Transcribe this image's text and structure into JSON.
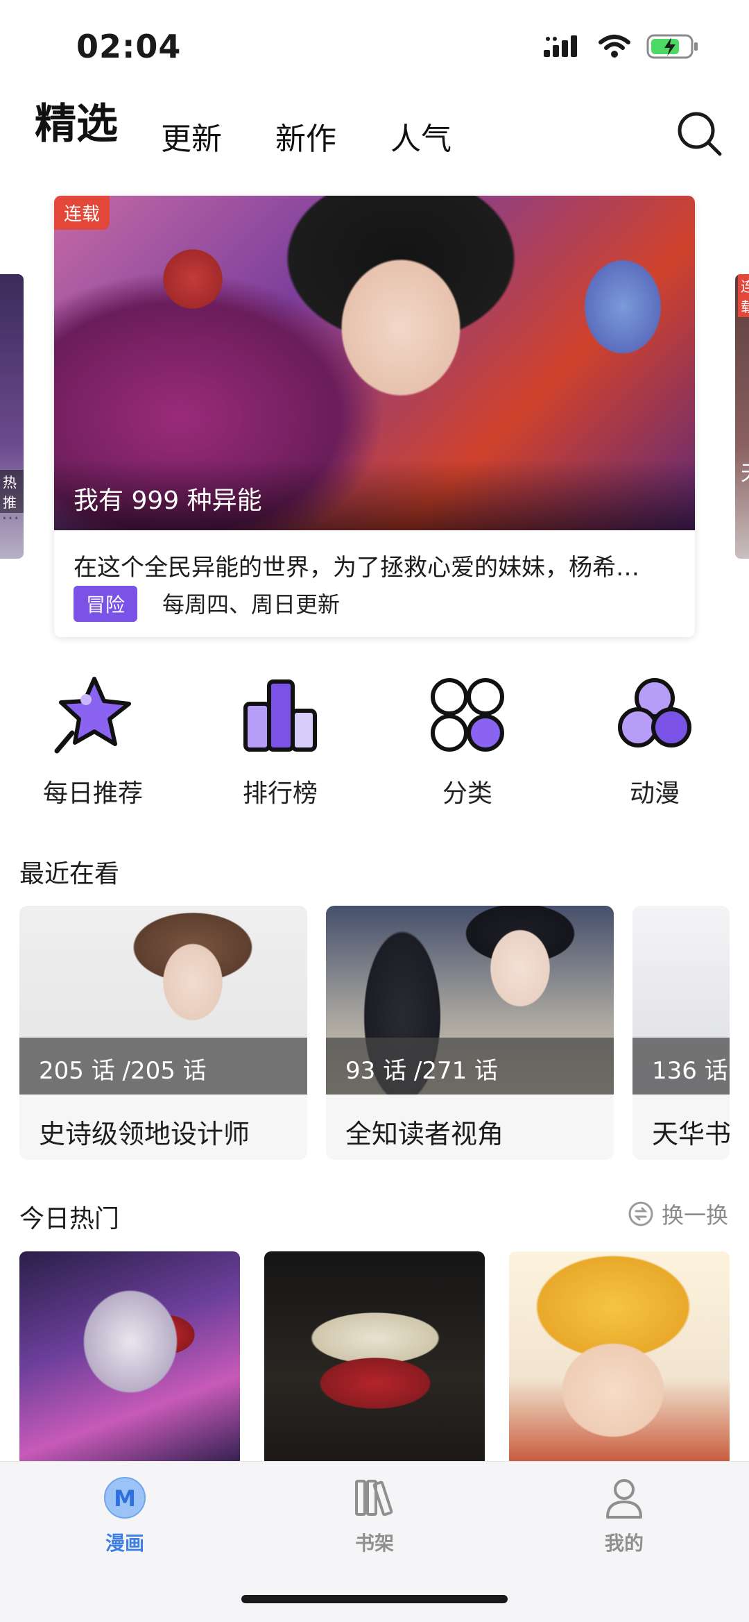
{
  "status_bar": {
    "time": "02:04"
  },
  "top_nav": {
    "tabs": [
      {
        "label": "精选",
        "active": true
      },
      {
        "label": "更新",
        "active": false
      },
      {
        "label": "新作",
        "active": false
      },
      {
        "label": "人气",
        "active": false
      }
    ]
  },
  "banner": {
    "left_peek_tag": "热推",
    "left_peek_text": "…",
    "right_peek_tag": "连载",
    "right_peek_text": "天",
    "badge": "连载",
    "art_title": "我有 999 种异能",
    "description": "在这个全民异能的世界，为了拯救心爱的妹妹，杨希…",
    "genre": "冒险",
    "schedule": "每周四、周日更新"
  },
  "shortcuts": [
    {
      "label": "每日推荐",
      "icon": "star-icon"
    },
    {
      "label": "排行榜",
      "icon": "bar-chart-icon"
    },
    {
      "label": "分类",
      "icon": "category-grid-icon"
    },
    {
      "label": "动漫",
      "icon": "anime-circles-icon"
    }
  ],
  "recent": {
    "title": "最近在看",
    "items": [
      {
        "progress": "205 话 /205 话",
        "title": "史诗级领地设计师"
      },
      {
        "progress": "93 话 /271 话",
        "title": "全知读者视角"
      },
      {
        "progress": "136 话",
        "title": "天华书"
      }
    ]
  },
  "hot": {
    "title": "今日热门",
    "refresh_label": "换一换"
  },
  "bottom_nav": [
    {
      "label": "漫画",
      "active": true,
      "icon": "comic-m-icon"
    },
    {
      "label": "书架",
      "active": false,
      "icon": "bookshelf-icon"
    },
    {
      "label": "我的",
      "active": false,
      "icon": "profile-icon"
    }
  ],
  "colors": {
    "accent_purple": "#7a52e6",
    "badge_red": "#e2473a",
    "nav_active_blue": "#3f7fe3"
  }
}
